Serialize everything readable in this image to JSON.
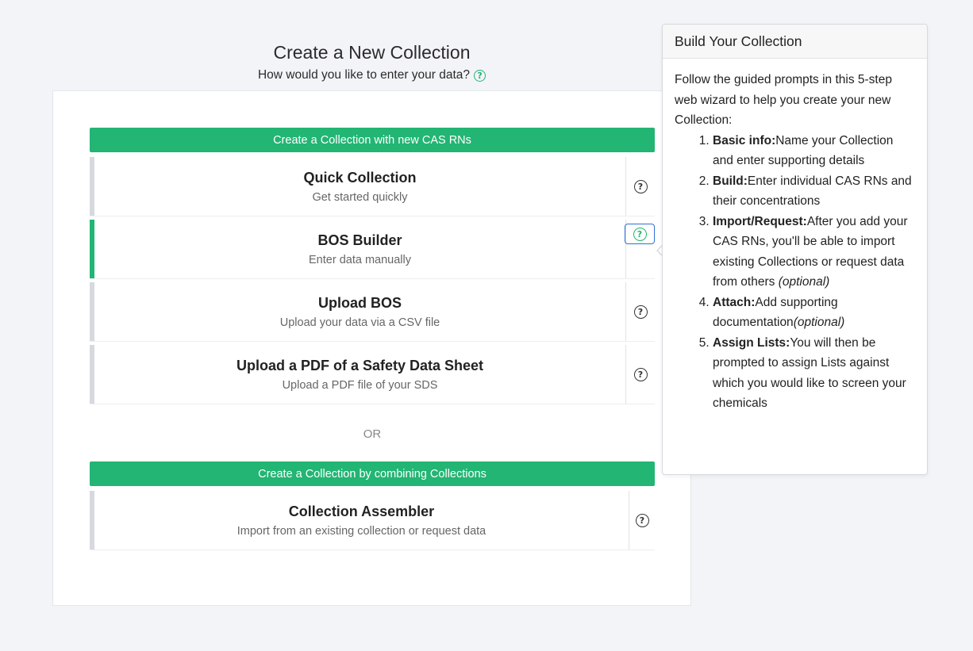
{
  "header": {
    "title": "Create a New Collection",
    "subtitle": "How would you like to enter your data?"
  },
  "sections": {
    "new_cas": "Create a Collection with new CAS RNs",
    "or": "OR",
    "combine": "Create a Collection by combining Collections"
  },
  "options": [
    {
      "title": "Quick Collection",
      "desc": "Get started quickly"
    },
    {
      "title": "BOS Builder",
      "desc": "Enter data manually"
    },
    {
      "title": "Upload BOS",
      "desc": "Upload your data via a CSV file"
    },
    {
      "title": "Upload a PDF of a Safety Data Sheet",
      "desc": "Upload a PDF file of your SDS"
    },
    {
      "title": "Collection Assembler",
      "desc": "Import from an existing collection or request data"
    }
  ],
  "popover": {
    "title": "Build Your Collection",
    "intro": "Follow the guided prompts in this 5-step web wizard to help you create your new Collection:",
    "steps": [
      {
        "label": "Basic info:",
        "text": "Name your Collection and enter supporting details",
        "note": ""
      },
      {
        "label": "Build:",
        "text": "Enter individual CAS RNs and their concentrations",
        "note": ""
      },
      {
        "label": "Import/Request:",
        "text": "After you add your CAS RNs, you'll be able to import existing Collections or request data from others",
        "note": "(optional)"
      },
      {
        "label": "Attach:",
        "text": "Add supporting documentation",
        "note": "(optional)"
      },
      {
        "label": "Assign Lists:",
        "text": "You will then be prompted to assign Lists against which you would like to screen your chemicals",
        "note": ""
      }
    ]
  },
  "icons": {
    "help": "?"
  },
  "colors": {
    "accent": "#22b573",
    "focus": "#2f6fd6",
    "background": "#f3f4f8"
  }
}
